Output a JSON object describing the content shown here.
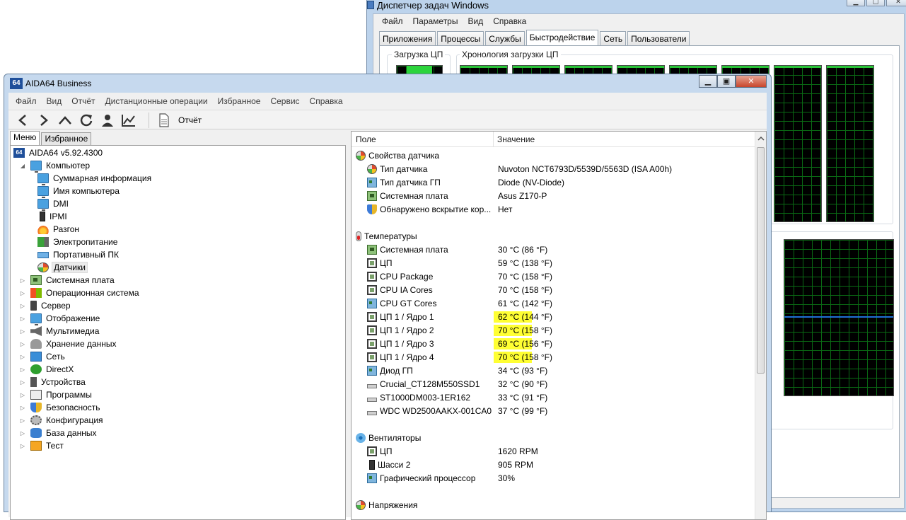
{
  "taskmgr": {
    "title": "Диспетчер задач Windows",
    "menu": [
      "Файл",
      "Параметры",
      "Вид",
      "Справка"
    ],
    "tabs": [
      "Приложения",
      "Процессы",
      "Службы",
      "Быстродействие",
      "Сеть",
      "Пользователи"
    ],
    "active_tab": "Быстродействие",
    "cpu_load_label": "Загрузка ЦП",
    "cpu_history_label": "Хронология загрузки ЦП"
  },
  "aida": {
    "logo_text": "64",
    "title": "AIDA64 Business",
    "menu": [
      "Файл",
      "Вид",
      "Отчёт",
      "Дистанционные операции",
      "Избранное",
      "Сервис",
      "Справка"
    ],
    "toolbar": {
      "report_label": "Отчёт"
    },
    "left_tabs": [
      "Меню",
      "Избранное"
    ],
    "tree": [
      {
        "label": "AIDA64 v5.92.4300",
        "icon": "aida-icon",
        "level": 0,
        "expander": ""
      },
      {
        "label": "Компьютер",
        "icon": "monitor-icon",
        "level": 1,
        "expander": "◢"
      },
      {
        "label": "Суммарная информация",
        "icon": "monitor-icon",
        "level": 2,
        "expander": ""
      },
      {
        "label": "Имя компьютера",
        "icon": "monitor-icon",
        "level": 2,
        "expander": ""
      },
      {
        "label": "DMI",
        "icon": "monitor-icon",
        "level": 2,
        "expander": ""
      },
      {
        "label": "IPMI",
        "icon": "tower-icon",
        "level": 2,
        "expander": ""
      },
      {
        "label": "Разгон",
        "icon": "fire-icon",
        "level": 2,
        "expander": ""
      },
      {
        "label": "Электропитание",
        "icon": "power-icon",
        "level": 2,
        "expander": ""
      },
      {
        "label": "Портативный ПК",
        "icon": "laptop-icon",
        "level": 2,
        "expander": ""
      },
      {
        "label": "Датчики",
        "icon": "gauge-icon",
        "level": 2,
        "expander": "",
        "selected": true
      },
      {
        "label": "Системная плата",
        "icon": "board-icon",
        "level": 1,
        "expander": "▷"
      },
      {
        "label": "Операционная система",
        "icon": "windows-icon",
        "level": 1,
        "expander": "▷"
      },
      {
        "label": "Сервер",
        "icon": "server-icon",
        "level": 1,
        "expander": "▷"
      },
      {
        "label": "Отображение",
        "icon": "monitor-icon",
        "level": 1,
        "expander": "▷"
      },
      {
        "label": "Мультимедиа",
        "icon": "speaker-icon",
        "level": 1,
        "expander": "▷"
      },
      {
        "label": "Хранение данных",
        "icon": "storage-icon",
        "level": 1,
        "expander": "▷"
      },
      {
        "label": "Сеть",
        "icon": "network-icon",
        "level": 1,
        "expander": "▷"
      },
      {
        "label": "DirectX",
        "icon": "xbox-icon",
        "level": 1,
        "expander": "▷"
      },
      {
        "label": "Устройства",
        "icon": "device-icon",
        "level": 1,
        "expander": "▷"
      },
      {
        "label": "Программы",
        "icon": "program-icon",
        "level": 1,
        "expander": "▷"
      },
      {
        "label": "Безопасность",
        "icon": "shield-icon",
        "level": 1,
        "expander": "▷"
      },
      {
        "label": "Конфигурация",
        "icon": "config-icon",
        "level": 1,
        "expander": "▷"
      },
      {
        "label": "База данных",
        "icon": "database-icon",
        "level": 1,
        "expander": "▷"
      },
      {
        "label": "Тест",
        "icon": "test-icon",
        "level": 1,
        "expander": "▷"
      }
    ],
    "columns": {
      "field": "Поле",
      "value": "Значение"
    },
    "rows": [
      {
        "type": "group",
        "field": "Свойства датчика",
        "icon": "gauge-icon"
      },
      {
        "field": "Тип датчика",
        "value": "Nuvoton NCT6793D/5539D/5563D  (ISA A00h)",
        "icon": "gauge-icon"
      },
      {
        "field": "Тип датчика ГП",
        "value": "Diode  (NV-Diode)",
        "icon": "gpu-icon"
      },
      {
        "field": "Системная плата",
        "value": "Asus Z170-P",
        "icon": "board-icon"
      },
      {
        "field": "Обнаружено вскрытие кор...",
        "value": "Нет",
        "icon": "shield-icon"
      },
      {
        "type": "spacer"
      },
      {
        "type": "group",
        "field": "Температуры",
        "icon": "thermometer-icon"
      },
      {
        "field": "Системная плата",
        "value": "30 °C  (86 °F)",
        "icon": "board-icon"
      },
      {
        "field": "ЦП",
        "value": "59 °C  (138 °F)",
        "icon": "chip-icon"
      },
      {
        "field": "CPU Package",
        "value": "70 °C  (158 °F)",
        "icon": "chip-icon"
      },
      {
        "field": "CPU IA Cores",
        "value": "70 °C  (158 °F)",
        "icon": "chip-icon"
      },
      {
        "field": "CPU GT Cores",
        "value": "61 °C  (142 °F)",
        "icon": "gpu-icon"
      },
      {
        "field": "ЦП 1 / Ядро 1",
        "value": "62 °C  (144 °F)",
        "icon": "chip-icon",
        "highlight": true
      },
      {
        "field": "ЦП 1 / Ядро 2",
        "value": "70 °C  (158 °F)",
        "icon": "chip-icon",
        "highlight": true
      },
      {
        "field": "ЦП 1 / Ядро 3",
        "value": "69 °C  (156 °F)",
        "icon": "chip-icon",
        "highlight": true
      },
      {
        "field": "ЦП 1 / Ядро 4",
        "value": "70 °C  (158 °F)",
        "icon": "chip-icon",
        "highlight": true
      },
      {
        "field": "Диод ГП",
        "value": "34 °C  (93 °F)",
        "icon": "gpu-icon"
      },
      {
        "field": "Crucial_CT128M550SSD1",
        "value": "32 °C  (90 °F)",
        "icon": "disk-icon"
      },
      {
        "field": "ST1000DM003-1ER162",
        "value": "33 °C  (91 °F)",
        "icon": "disk-icon"
      },
      {
        "field": "WDC WD2500AAKX-001CA0",
        "value": "37 °C  (99 °F)",
        "icon": "disk-icon"
      },
      {
        "type": "spacer"
      },
      {
        "type": "group",
        "field": "Вентиляторы",
        "icon": "fan-icon"
      },
      {
        "field": "ЦП",
        "value": "1620 RPM",
        "icon": "chip-icon"
      },
      {
        "field": "Шасси 2",
        "value": "905 RPM",
        "icon": "tower-icon"
      },
      {
        "field": "Графический процессор",
        "value": "30%",
        "icon": "gpu-icon"
      },
      {
        "type": "spacer"
      },
      {
        "type": "group",
        "field": "Напряжения",
        "icon": "gauge-icon"
      }
    ]
  }
}
